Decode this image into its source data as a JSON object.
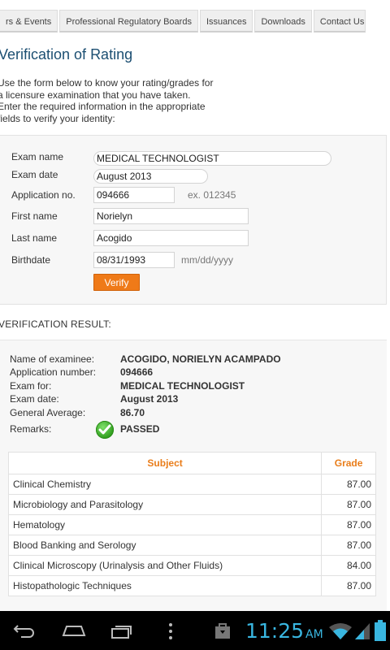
{
  "nav": {
    "tabs": [
      "rs & Events",
      "Professional Regulatory Boards",
      "Issuances",
      "Downloads",
      "Contact Us"
    ]
  },
  "page": {
    "title": "Verification of Rating",
    "intro": [
      "Use the form below to know your rating/grades for",
      "a licensure examination that you have taken.",
      "Enter the required information in the appropriate",
      "fields to verify your identity:"
    ]
  },
  "form": {
    "exam_name_label": "Exam name",
    "exam_name_value": "MEDICAL TECHNOLOGIST",
    "exam_date_label": "Exam date",
    "exam_date_value": "August 2013",
    "application_no_label": "Application no.",
    "application_no_value": "094666",
    "application_no_hint": "ex. 012345",
    "first_name_label": "First name",
    "first_name_value": "Norielyn",
    "last_name_label": "Last name",
    "last_name_value": "Acogido",
    "birthdate_label": "Birthdate",
    "birthdate_value": "08/31/1993",
    "birthdate_hint": "mm/dd/yyyy",
    "verify_label": "Verify"
  },
  "result": {
    "heading": "VERIFICATION RESULT:",
    "name_label": "Name of examinee:",
    "name_value": "ACOGIDO, NORIELYN ACAMPADO",
    "appno_label": "Application number:",
    "appno_value": "094666",
    "exam_for_label": "Exam for:",
    "exam_for_value": "MEDICAL TECHNOLOGIST",
    "exam_date_label": "Exam date:",
    "exam_date_value": "August 2013",
    "average_label": "General Average:",
    "average_value": "86.70",
    "remarks_label": "Remarks:",
    "remarks_value": "PASSED",
    "remarks_icon": "check-circle-icon"
  },
  "grades": {
    "headers": [
      "Subject",
      "Grade"
    ],
    "rows": [
      {
        "subject": "Clinical Chemistry",
        "grade": "87.00"
      },
      {
        "subject": "Microbiology and Parasitology",
        "grade": "87.00"
      },
      {
        "subject": "Hematology",
        "grade": "87.00"
      },
      {
        "subject": "Blood Banking and Serology",
        "grade": "87.00"
      },
      {
        "subject": "Clinical Microscopy (Urinalysis and Other Fluids)",
        "grade": "84.00"
      },
      {
        "subject": "Histopathologic Techniques",
        "grade": "87.00"
      }
    ]
  },
  "status_bar": {
    "time": "11:25",
    "ampm": "AM",
    "icons": [
      "back-icon",
      "home-icon",
      "recent-apps-icon",
      "menu-icon",
      "shopping-bag-icon",
      "wifi-icon",
      "signal-icon",
      "battery-icon"
    ],
    "accent": "#39b6e0"
  },
  "colors": {
    "title": "#1c4f72",
    "verify_button": "#ef7a18",
    "table_header": "#e97d1a",
    "passed_check": "#2f9d1c"
  }
}
